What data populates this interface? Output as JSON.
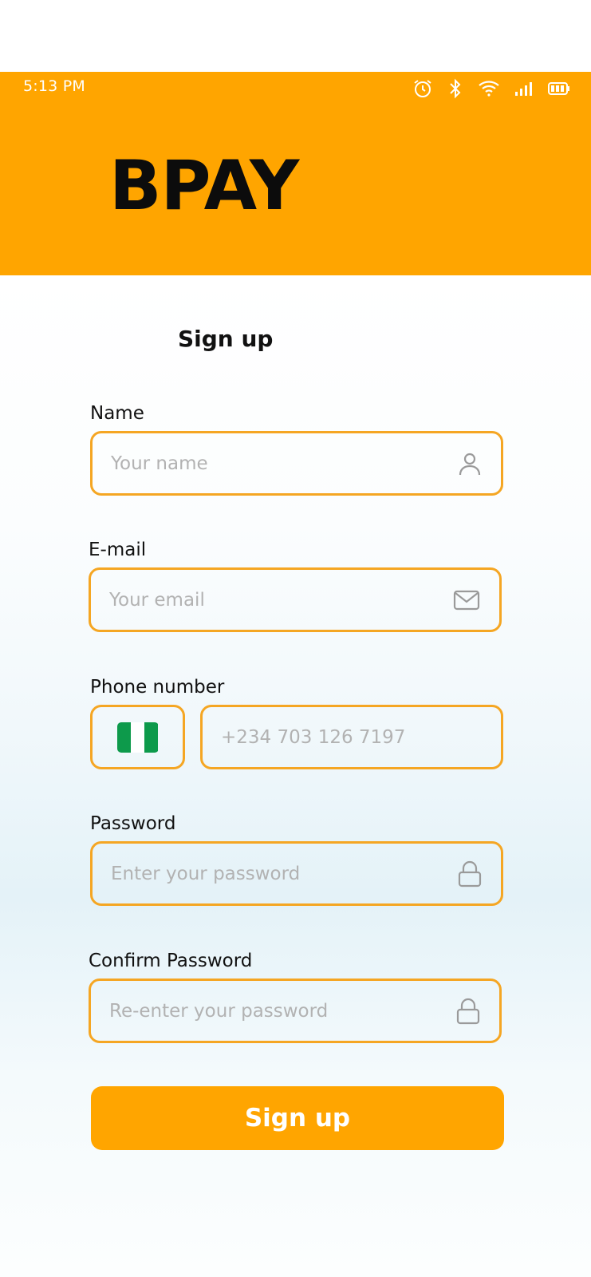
{
  "status_bar": {
    "time": "5:13 PM",
    "icons": [
      "alarm-icon",
      "bluetooth-icon",
      "wifi-icon",
      "signal-icon",
      "battery-icon"
    ]
  },
  "header": {
    "brand": "BPAY",
    "color": "#FFA500"
  },
  "form": {
    "title": "Sign up",
    "name": {
      "label": "Name",
      "placeholder": "Your name",
      "icon": "user-icon"
    },
    "email": {
      "label": "E-mail",
      "placeholder": "Your email",
      "icon": "mail-icon"
    },
    "phone": {
      "label": "Phone number",
      "country_icon": "nigeria-flag-icon",
      "placeholder": "+234 703 126 7197"
    },
    "password": {
      "label": "Password",
      "placeholder": "Enter your password",
      "icon": "lock-icon"
    },
    "confirm_password": {
      "label": "Confirm Password",
      "placeholder": "Re-enter your password",
      "icon": "lock-icon"
    },
    "submit_label": "Sign up",
    "accent_color": "#F5A623"
  }
}
